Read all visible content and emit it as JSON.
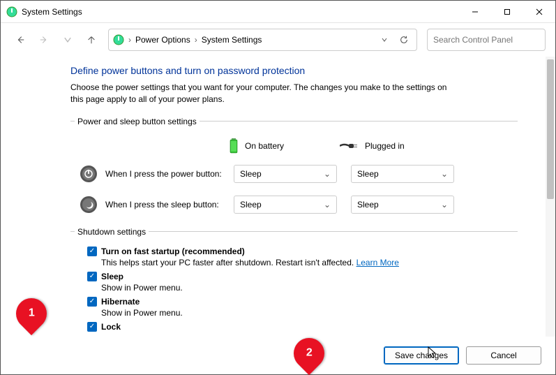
{
  "window": {
    "title": "System Settings"
  },
  "breadcrumb": {
    "parent": "Power Options",
    "current": "System Settings"
  },
  "search": {
    "placeholder": "Search Control Panel"
  },
  "page": {
    "heading": "Define power buttons and turn on password protection",
    "description": "Choose the power settings that you want for your computer. The changes you make to the settings on this page apply to all of your power plans."
  },
  "power_group": {
    "legend": "Power and sleep button settings",
    "col_battery": "On battery",
    "col_plugged": "Plugged in",
    "rows": {
      "power_button": {
        "label": "When I press the power button:",
        "battery": "Sleep",
        "plugged": "Sleep"
      },
      "sleep_button": {
        "label": "When I press the sleep button:",
        "battery": "Sleep",
        "plugged": "Sleep"
      }
    }
  },
  "shutdown_group": {
    "legend": "Shutdown settings",
    "items": {
      "fast_startup": {
        "label": "Turn on fast startup (recommended)",
        "sub": "This helps start your PC faster after shutdown. Restart isn't affected. ",
        "link": "Learn More",
        "checked": true
      },
      "sleep": {
        "label": "Sleep",
        "sub": "Show in Power menu.",
        "checked": true
      },
      "hibernate": {
        "label": "Hibernate",
        "sub": "Show in Power menu.",
        "checked": true
      },
      "lock": {
        "label": "Lock",
        "checked": true
      }
    }
  },
  "footer": {
    "save": "Save changes",
    "cancel": "Cancel"
  },
  "callouts": {
    "one": "1",
    "two": "2"
  }
}
